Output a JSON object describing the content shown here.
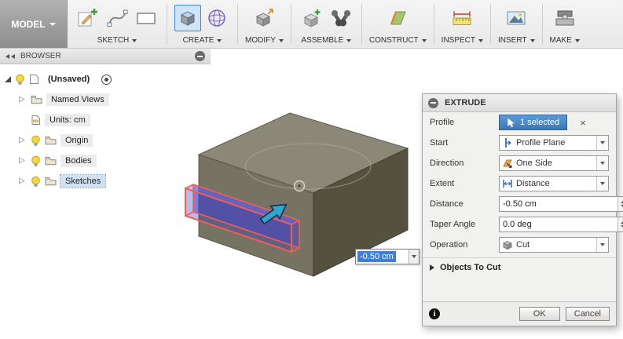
{
  "toolbar": {
    "model_button": {
      "label": "MODEL"
    },
    "groups": [
      {
        "label": "SKETCH"
      },
      {
        "label": "CREATE"
      },
      {
        "label": "MODIFY"
      },
      {
        "label": "ASSEMBLE"
      },
      {
        "label": "CONSTRUCT"
      },
      {
        "label": "INSPECT"
      },
      {
        "label": "INSERT"
      },
      {
        "label": "MAKE"
      }
    ]
  },
  "browser": {
    "title": "BROWSER",
    "root_item": {
      "label": "(Unsaved)"
    },
    "items": [
      {
        "label": "Named Views"
      },
      {
        "label": "Units: cm"
      },
      {
        "label": "Origin"
      },
      {
        "label": "Bodies"
      },
      {
        "label": "Sketches"
      }
    ]
  },
  "viewport": {
    "dimension_input": {
      "value": "-0.50 cm"
    }
  },
  "extrude_dialog": {
    "title": "EXTRUDE",
    "fields": {
      "profile": {
        "label": "Profile",
        "value": "1 selected"
      },
      "start": {
        "label": "Start",
        "value": "Profile Plane"
      },
      "direction": {
        "label": "Direction",
        "value": "One Side"
      },
      "extent": {
        "label": "Extent",
        "value": "Distance"
      },
      "distance": {
        "label": "Distance",
        "value": "-0.50 cm"
      },
      "taper_angle": {
        "label": "Taper Angle",
        "value": "0.0 deg"
      },
      "operation": {
        "label": "Operation",
        "value": "Cut"
      }
    },
    "sections": {
      "objects_to_cut": "Objects To Cut"
    },
    "buttons": {
      "ok": "OK",
      "cancel": "Cancel"
    }
  },
  "icons": {
    "expander_collapsed": "▷",
    "close": "×",
    "info": "i"
  },
  "colors": {
    "accent_blue": "#3f86c6",
    "selection_blue": "#3d7fd9",
    "profile_button": "#3a77b7",
    "sketch_red": "#f25c5c",
    "cut_preview_blue": "rgba(70,70,205,0.55)",
    "body_top": "#8b8878",
    "body_front": "#767363",
    "body_side": "#54513f"
  }
}
